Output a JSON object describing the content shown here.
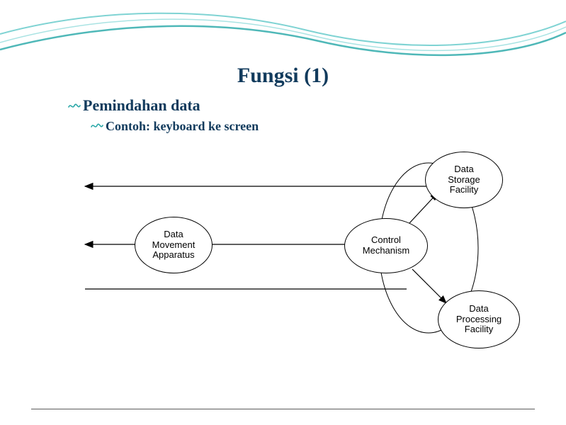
{
  "title": "Fungsi (1)",
  "bullet1": "Pemindahan data",
  "bullet2": "Contoh: keyboard ke screen",
  "nodes": {
    "storage": "Data\nStorage\nFacility",
    "movement": "Data\nMovement\nApparatus",
    "control": "Control\nMechanism",
    "processing": "Data\nProcessing\nFacility"
  },
  "wave_color": "#7fd3d3",
  "accent_color": "#2aa7a7"
}
